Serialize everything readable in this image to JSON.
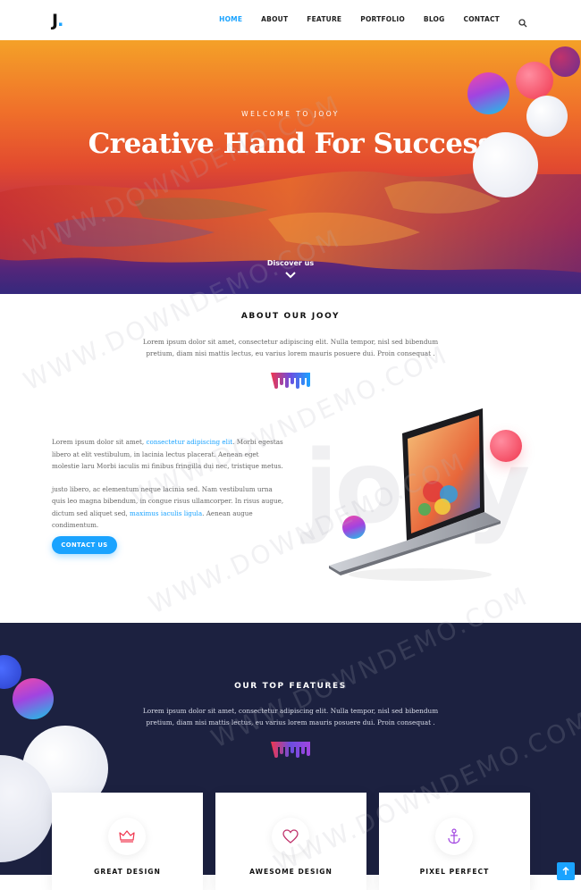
{
  "nav": {
    "logo": "J",
    "logo_dot": ".",
    "items": [
      "HOME",
      "ABOUT",
      "FEATURE",
      "PORTFOLIO",
      "BLOG",
      "CONTACT"
    ],
    "active_index": 0,
    "search_icon": "search-icon"
  },
  "hero": {
    "eyebrow": "WELCOME TO JOOY",
    "title": "Creative Hand For Success",
    "discover": "Discover us",
    "scroll_icon": "chevron-down-icon"
  },
  "about": {
    "title": "ABOUT OUR JOOY",
    "description": "Lorem ipsum dolor sit amet, consectetur adipiscing elit. Nulla tempor, nisl sed bibendum pretium, diam nisi mattis lectus, eu varius lorem mauris posuere dui. Proin consequat .",
    "para1_a": "Lorem ipsum dolor sit amet, ",
    "para1_link": "consectetur adipiscing elit",
    "para1_b": ". Morbi egestas libero at elit vestibulum, in lacinia lectus placerat. Aenean eget molestie laru Morbi iaculis mi finibus fringilla dui nec, tristique metus.",
    "para2_a": "justo libero, ac elementum neque lacinia sed. Nam vestibulum urna quis leo magna bibendum, in congue risus ullamcorper. In risus augue, dictum sed aliquet sed, ",
    "para2_link": "maximus iaculis ligula",
    "para2_b": ". Aenean augue condimentum.",
    "button": "CONTACT US",
    "big_word": "jooy"
  },
  "features": {
    "title": "OUR TOP FEATURES",
    "description": "Lorem ipsum dolor sit amet, consectetur adipiscing elit. Nulla tempor, nisl sed bibendum pretium, diam nisi mattis lectus, eu varius lorem mauris posuere dui. Proin consequat .",
    "cards": [
      {
        "title": "GREAT DESIGN",
        "icon": "crown-icon"
      },
      {
        "title": "AWESOME DESIGN",
        "icon": "heart-icon"
      },
      {
        "title": "PIXEL PERFECT",
        "icon": "anchor-icon"
      }
    ]
  },
  "watermark": "WWW.DOWNDEMO.COM",
  "colors": {
    "accent": "#1aa3ff",
    "dark": "#1c2140"
  }
}
